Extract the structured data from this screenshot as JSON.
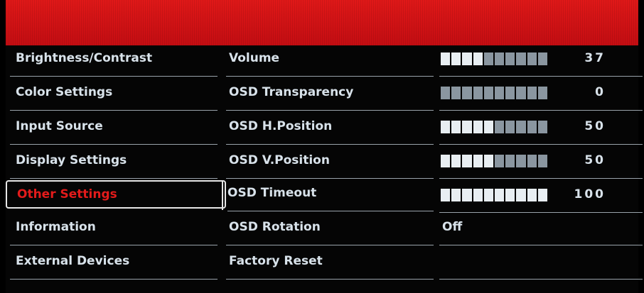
{
  "menu": {
    "categories": [
      "Brightness/Contrast",
      "Color Settings",
      "Input Source",
      "Display Settings",
      "Other Settings",
      "Information",
      "External Devices"
    ],
    "selected_category": "Other Settings"
  },
  "settings": [
    {
      "label": "Volume",
      "type": "bar",
      "value": "37",
      "level": 0.37
    },
    {
      "label": "OSD Transparency",
      "type": "bar",
      "value": "0",
      "level": 0.0
    },
    {
      "label": "OSD H.Position",
      "type": "bar",
      "value": "50",
      "level": 0.5
    },
    {
      "label": "OSD V.Position",
      "type": "bar",
      "value": "50",
      "level": 0.5
    },
    {
      "label": "OSD Timeout",
      "type": "bar",
      "value": "100",
      "level": 1.0
    },
    {
      "label": "OSD Rotation",
      "type": "text",
      "value": "Off"
    },
    {
      "label": "Factory Reset",
      "type": "none",
      "value": ""
    }
  ],
  "colors": {
    "header": "#d41317",
    "selected_text": "#e31b1b",
    "text": "#d8e2ea"
  }
}
